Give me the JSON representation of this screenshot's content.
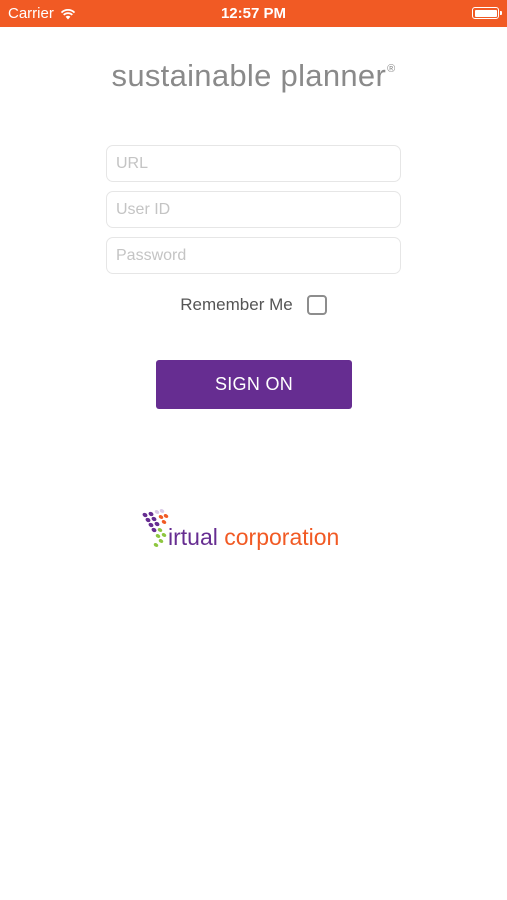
{
  "status_bar": {
    "carrier": "Carrier",
    "time": "12:57 PM",
    "background": "#f15a24"
  },
  "app": {
    "title": "sustainable planner",
    "trademark": "®"
  },
  "form": {
    "url_placeholder": "URL",
    "userid_placeholder": "User ID",
    "password_placeholder": "Password",
    "remember_label": "Remember Me",
    "remember_checked": false,
    "signon_label": "SIGN ON"
  },
  "logo": {
    "word1": "irtual",
    "word2": "corporation",
    "color_primary": "#662d91",
    "color_secondary": "#f15a24",
    "color_accent": "#8dc63f"
  },
  "colors": {
    "accent": "#662d91",
    "status_bar": "#f15a24"
  }
}
